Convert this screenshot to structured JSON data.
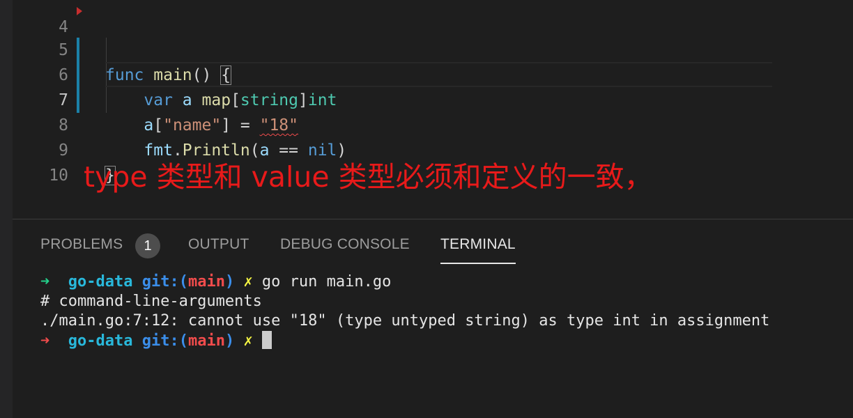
{
  "editor": {
    "lines": [
      {
        "num": "4"
      },
      {
        "num": "5",
        "func_kw": "func",
        "func_name": "main",
        "parens": "() ",
        "brace_open": "{"
      },
      {
        "num": "6",
        "indent": "    ",
        "var_kw": "var",
        "ident": "a",
        "map_kw": "map",
        "bracket_open": "[",
        "key_type": "string",
        "bracket_close": "]",
        "val_type": "int"
      },
      {
        "num": "7",
        "indent": "    ",
        "ident": "a",
        "bracket_open": "[",
        "key_str": "\"name\"",
        "assign": "] = ",
        "val_str": "\"18\""
      },
      {
        "num": "8",
        "indent": "    ",
        "pkg": "fmt",
        "dot": ".",
        "call": "Println",
        "paren_open": "(",
        "ident": "a",
        "op": " == ",
        "nil_kw": "nil",
        "paren_close": ")"
      },
      {
        "num": "9",
        "brace_close": "}"
      },
      {
        "num": "10"
      }
    ],
    "active_line": "7"
  },
  "annotation": "type 类型和 value 类型必须和定义的一致，",
  "panel": {
    "tabs": [
      {
        "label": "PROBLEMS",
        "badge": "1"
      },
      {
        "label": "OUTPUT"
      },
      {
        "label": "DEBUG CONSOLE"
      },
      {
        "label": "TERMINAL",
        "active": true
      }
    ],
    "terminal": {
      "line1": {
        "arrow": "➜",
        "dir": "go-data",
        "git": "git:(",
        "branch": "main",
        "git_close": ")",
        "mark": "✗",
        "cmd": " go run main.go"
      },
      "line2": "# command-line-arguments",
      "line3": "./main.go:7:12: cannot use \"18\" (type untyped string) as type int in assignment",
      "line4": {
        "arrow": "➜",
        "dir": "go-data",
        "git": "git:(",
        "branch": "main",
        "git_close": ")",
        "mark": "✗"
      }
    }
  },
  "colors": {
    "keyword": "#569cd6",
    "function": "#dcdcaa",
    "variable": "#9cdcfe",
    "type": "#4ec9b0",
    "string": "#ce9178",
    "annotation": "#e81a1a",
    "error_squiggle": "#f14c4c"
  }
}
